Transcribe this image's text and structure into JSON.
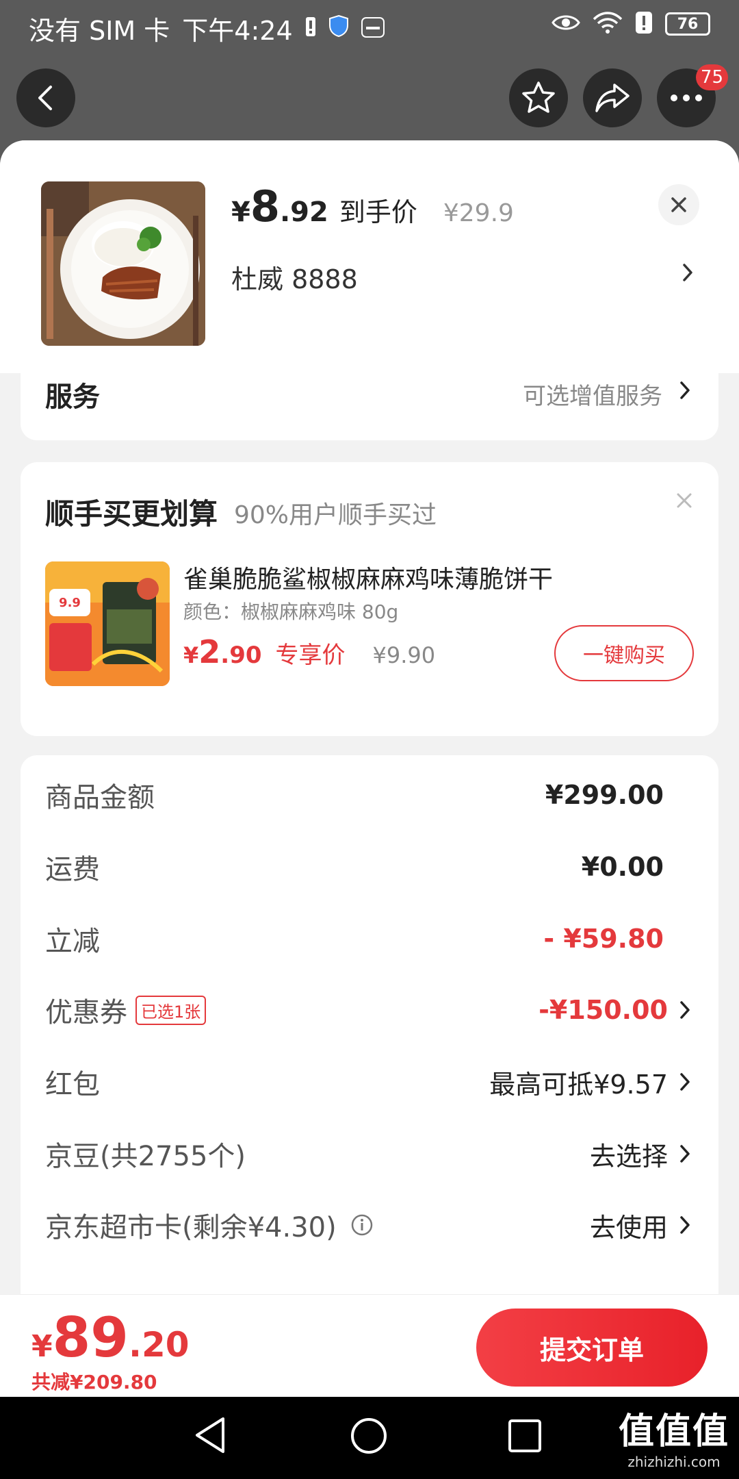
{
  "status_bar": {
    "carrier": "没有 SIM 卡",
    "time": "下午4:24",
    "battery": "76"
  },
  "nav": {
    "badge_count": "75"
  },
  "product": {
    "price_symbol": "¥",
    "price_int": "8",
    "price_dec": ".92",
    "price_tag": "到手价",
    "original_price": "¥29.9",
    "spec": "杜威  8888"
  },
  "service": {
    "title": "服务",
    "hint": "可选增值服务"
  },
  "addon": {
    "title": "顺手买更划算",
    "subtitle": "90%用户顺手买过",
    "item": {
      "name": "雀巢脆脆鲨椒椒麻麻鸡味薄脆饼干",
      "spec": "颜色：椒椒麻麻鸡味 80g",
      "price_symbol": "¥",
      "price_int": "2",
      "price_dec": ".90",
      "price_tag": "专享价",
      "original_price": "¥9.90",
      "buy_label": "一键购买"
    }
  },
  "fees": {
    "goods_label": "商品金额",
    "goods_value": "¥299.00",
    "shipping_label": "运费",
    "shipping_value": "¥0.00",
    "discount_label": "立减",
    "discount_value": "- ¥59.80",
    "coupon_label": "优惠券",
    "coupon_chip": "已选1张",
    "coupon_value": "-¥150.00",
    "redpacket_label": "红包",
    "redpacket_value": "最高可抵¥9.57",
    "beans_label": "京豆(共2755个)",
    "beans_value": "去选择",
    "card_label": "京东超市卡(剩余¥4.30)",
    "card_value": "去使用"
  },
  "bottom": {
    "total_symbol": "¥",
    "total_int": "89",
    "total_dec": ".20",
    "saved": "共减¥209.80",
    "submit_label": "提交订单"
  },
  "watermark": {
    "logo": "值值值",
    "url": "zhizhizhi.com"
  },
  "colors": {
    "accent": "#e4393c",
    "overlay": "#5a5a5a",
    "sheet_bg": "#f2f2f2"
  }
}
